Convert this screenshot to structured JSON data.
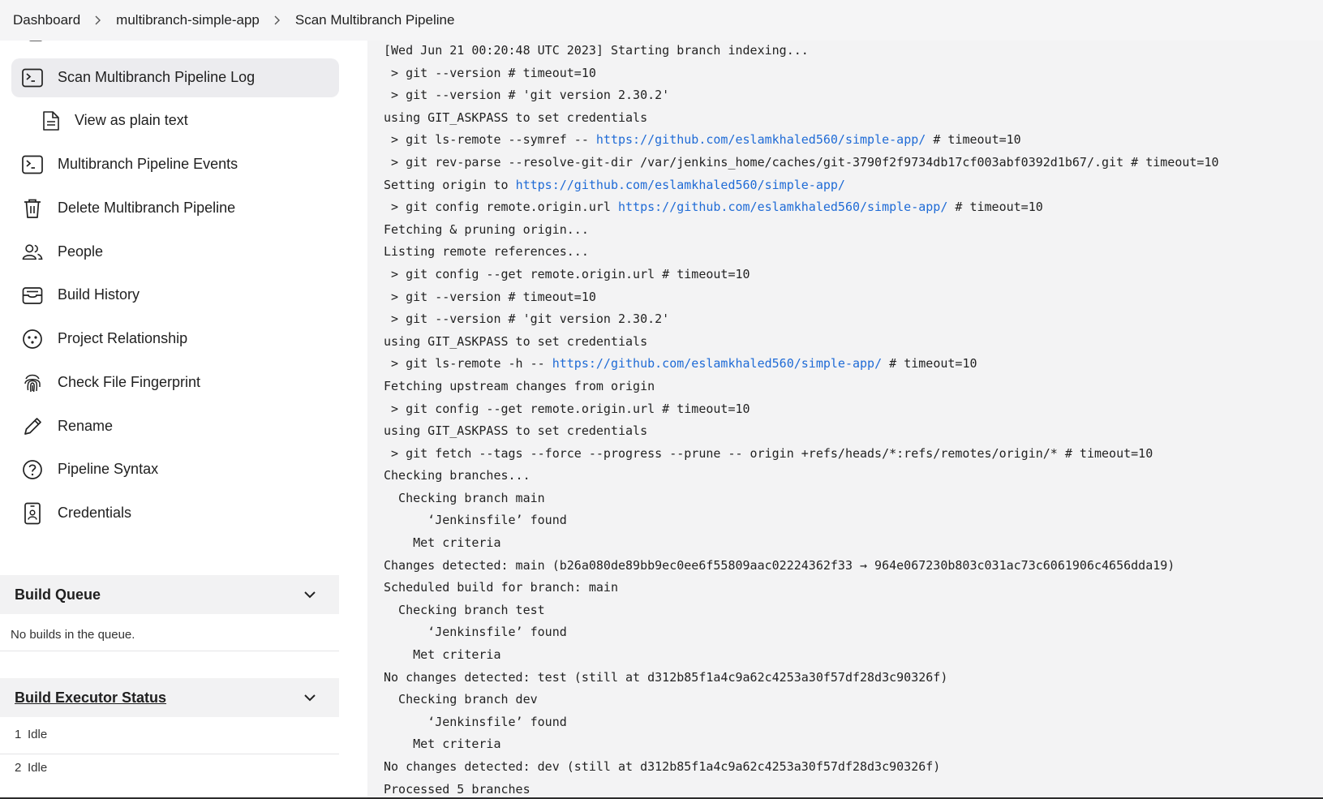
{
  "breadcrumb": [
    "Dashboard",
    "multibranch-simple-app",
    "Scan Multibranch Pipeline"
  ],
  "sidebar": {
    "items": [
      {
        "label": "Scan Multibranch Pipeline Log",
        "icon": "terminal-icon",
        "active": true
      },
      {
        "label": "View as plain text",
        "icon": "document-icon",
        "sub": true
      },
      {
        "label": "Multibranch Pipeline Events",
        "icon": "terminal-icon"
      },
      {
        "label": "Delete Multibranch Pipeline",
        "icon": "trash-icon"
      },
      {
        "label": "People",
        "icon": "people-icon"
      },
      {
        "label": "Build History",
        "icon": "archive-icon"
      },
      {
        "label": "Project Relationship",
        "icon": "relationship-icon"
      },
      {
        "label": "Check File Fingerprint",
        "icon": "fingerprint-icon"
      },
      {
        "label": "Rename",
        "icon": "pencil-icon"
      },
      {
        "label": "Pipeline Syntax",
        "icon": "help-icon"
      },
      {
        "label": "Credentials",
        "icon": "credentials-icon"
      }
    ]
  },
  "build_queue": {
    "title": "Build Queue",
    "empty_text": "No builds in the queue."
  },
  "executors": {
    "title": "Build Executor Status",
    "rows": [
      {
        "num": "1",
        "status": "Idle"
      },
      {
        "num": "2",
        "status": "Idle"
      }
    ]
  },
  "console": {
    "lines": [
      [
        {
          "t": "[Wed Jun 21 00:20:48 UTC 2023] Starting branch indexing..."
        }
      ],
      [
        {
          "t": " > git --version # timeout=10"
        }
      ],
      [
        {
          "t": " > git --version # 'git version 2.30.2'"
        }
      ],
      [
        {
          "t": "using GIT_ASKPASS to set credentials"
        }
      ],
      [
        {
          "t": " > git ls-remote --symref -- "
        },
        {
          "t": "https://github.com/eslamkhaled560/simple-app/",
          "link": true
        },
        {
          "t": " # timeout=10"
        }
      ],
      [
        {
          "t": " > git rev-parse --resolve-git-dir /var/jenkins_home/caches/git-3790f2f9734db17cf003abf0392d1b67/.git # timeout=10"
        }
      ],
      [
        {
          "t": "Setting origin to "
        },
        {
          "t": "https://github.com/eslamkhaled560/simple-app/",
          "link": true
        }
      ],
      [
        {
          "t": " > git config remote.origin.url "
        },
        {
          "t": "https://github.com/eslamkhaled560/simple-app/",
          "link": true
        },
        {
          "t": " # timeout=10"
        }
      ],
      [
        {
          "t": "Fetching & pruning origin..."
        }
      ],
      [
        {
          "t": "Listing remote references..."
        }
      ],
      [
        {
          "t": " > git config --get remote.origin.url # timeout=10"
        }
      ],
      [
        {
          "t": " > git --version # timeout=10"
        }
      ],
      [
        {
          "t": " > git --version # 'git version 2.30.2'"
        }
      ],
      [
        {
          "t": "using GIT_ASKPASS to set credentials"
        }
      ],
      [
        {
          "t": " > git ls-remote -h -- "
        },
        {
          "t": "https://github.com/eslamkhaled560/simple-app/",
          "link": true
        },
        {
          "t": " # timeout=10"
        }
      ],
      [
        {
          "t": "Fetching upstream changes from origin"
        }
      ],
      [
        {
          "t": " > git config --get remote.origin.url # timeout=10"
        }
      ],
      [
        {
          "t": "using GIT_ASKPASS to set credentials"
        }
      ],
      [
        {
          "t": " > git fetch --tags --force --progress --prune -- origin +refs/heads/*:refs/remotes/origin/* # timeout=10"
        }
      ],
      [
        {
          "t": "Checking branches..."
        }
      ],
      [
        {
          "t": "  Checking branch main"
        }
      ],
      [
        {
          "t": "      ‘Jenkinsfile’ found"
        }
      ],
      [
        {
          "t": "    Met criteria"
        }
      ],
      [
        {
          "t": "Changes detected: main (b26a080de89bb9ec0ee6f55809aac02224362f33 → 964e067230b803c031ac73c6061906c4656dda19)"
        }
      ],
      [
        {
          "t": "Scheduled build for branch: main"
        }
      ],
      [
        {
          "t": "  Checking branch test"
        }
      ],
      [
        {
          "t": "      ‘Jenkinsfile’ found"
        }
      ],
      [
        {
          "t": "    Met criteria"
        }
      ],
      [
        {
          "t": "No changes detected: test (still at d312b85f1a4c9a62c4253a30f57df28d3c90326f)"
        }
      ],
      [
        {
          "t": "  Checking branch dev"
        }
      ],
      [
        {
          "t": "      ‘Jenkinsfile’ found"
        }
      ],
      [
        {
          "t": "    Met criteria"
        }
      ],
      [
        {
          "t": "No changes detected: dev (still at d312b85f1a4c9a62c4253a30f57df28d3c90326f)"
        }
      ],
      [
        {
          "t": "Processed 5 branches"
        }
      ]
    ]
  },
  "colors": {
    "link": "#1f6bd6",
    "console_bg": "#f3f3f4",
    "active_bg": "#ececef"
  }
}
